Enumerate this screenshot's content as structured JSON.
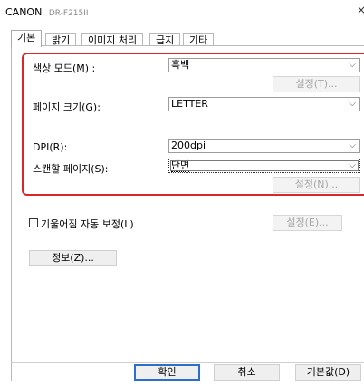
{
  "window": {
    "brand": "CANON",
    "model": "DR-F215II",
    "close_glyph": "×"
  },
  "tabs": [
    {
      "label": "기본",
      "active": true
    },
    {
      "label": "밝기",
      "active": false
    },
    {
      "label": "이미지 처리",
      "active": false
    },
    {
      "label": "급지",
      "active": false
    },
    {
      "label": "기타",
      "active": false
    }
  ],
  "settings": {
    "color_mode": {
      "label": "색상 모드(M) :",
      "value": "흑백"
    },
    "color_mode_settings": "설정(T)...",
    "page_size": {
      "label": "페이지 크기(G):",
      "value": "LETTER"
    },
    "dpi": {
      "label": "DPI(R):",
      "value": "200dpi"
    },
    "scan_side": {
      "label": "스캔할 페이지(S):",
      "value": "단면"
    },
    "scan_side_settings": "설정(N)..."
  },
  "deskew": {
    "label": "기울어짐 자동 보정(L)",
    "checked": false,
    "settings": "설정(E)..."
  },
  "info_button": "정보(Z)...",
  "footer": {
    "ok": "확인",
    "cancel": "취소",
    "default": "기본값(D)"
  },
  "colors": {
    "highlight_frame": "#d9262b",
    "focus_blue": "#2b6fc9"
  }
}
